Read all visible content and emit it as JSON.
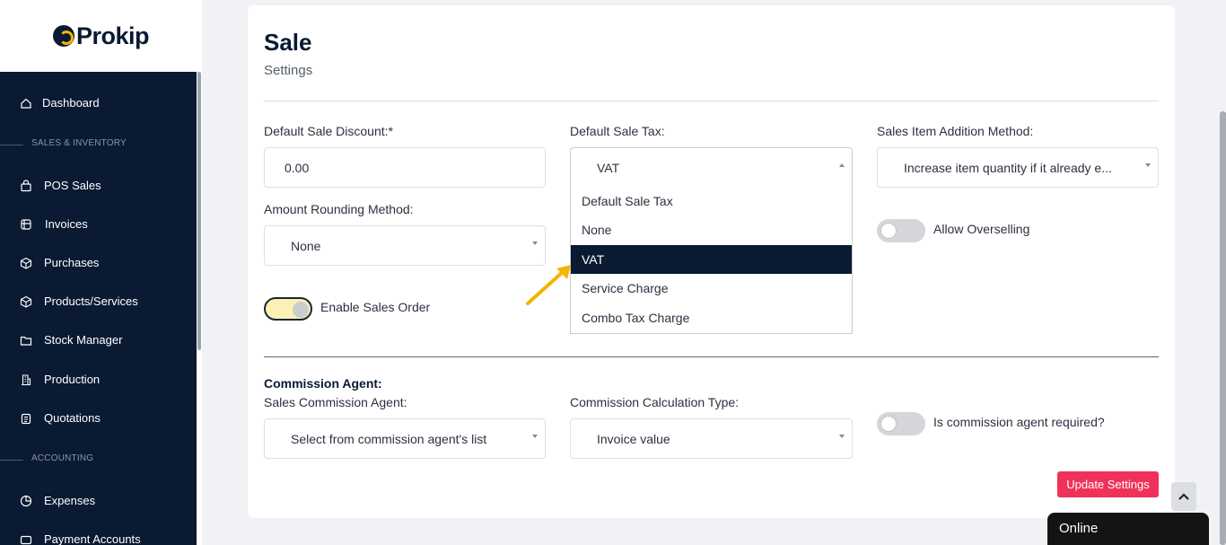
{
  "brand": {
    "name": "Prokip"
  },
  "sidebar": {
    "items": [
      {
        "label": "Dashboard"
      },
      {
        "section": "SALES & INVENTORY"
      },
      {
        "label": "POS Sales"
      },
      {
        "label": "Invoices"
      },
      {
        "label": "Purchases"
      },
      {
        "label": "Products/Services"
      },
      {
        "label": "Stock Manager"
      },
      {
        "label": "Production"
      },
      {
        "label": "Quotations"
      },
      {
        "section": "ACCOUNTING"
      },
      {
        "label": "Expenses"
      },
      {
        "label": "Payment Accounts"
      }
    ]
  },
  "page": {
    "title": "Sale",
    "subtitle": "Settings"
  },
  "form": {
    "default_sale_discount": {
      "label": "Default Sale Discount:*",
      "value": "0.00"
    },
    "default_sale_tax": {
      "label": "Default Sale Tax:",
      "value": "VAT",
      "options": [
        "Default Sale Tax",
        "None",
        "VAT",
        "Service Charge",
        "Combo Tax Charge"
      ],
      "selected": "VAT"
    },
    "sales_item_addition_method": {
      "label": "Sales Item Addition Method:",
      "value": "Increase item quantity if it already e..."
    },
    "amount_rounding_method": {
      "label": "Amount Rounding Method:",
      "value": "None"
    },
    "allow_overselling": {
      "label": "Allow Overselling",
      "on": false
    },
    "enable_sales_order": {
      "label": "Enable Sales Order",
      "on": true
    },
    "commission_agent_heading": "Commission Agent:",
    "sales_commission_agent": {
      "label": "Sales Commission Agent:",
      "value": "Select from commission agent's list"
    },
    "commission_calculation_type": {
      "label": "Commission Calculation Type:",
      "value": "Invoice value"
    },
    "commission_agent_required": {
      "label": "Is commission agent required?",
      "on": false
    },
    "update_button": "Update Settings"
  },
  "chat": {
    "status": "Online"
  },
  "colors": {
    "sidebar_bg": "#0a1a33",
    "accent_button": "#f0325a",
    "highlight_yellow": "#f5b400",
    "toggle_on_bg": "#fdf0b5"
  }
}
